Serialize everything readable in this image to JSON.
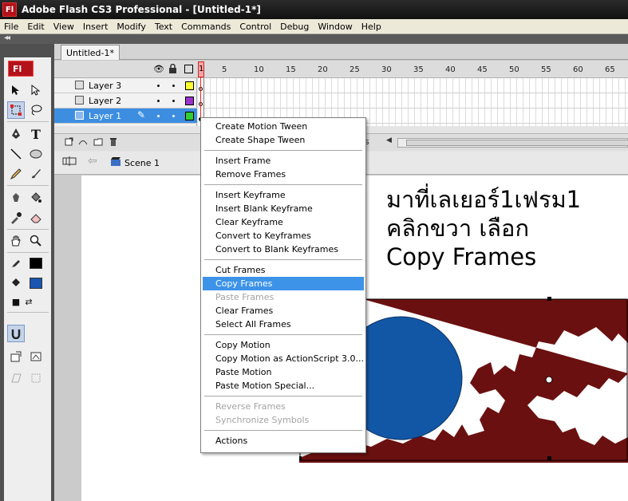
{
  "window": {
    "app_icon": "Fl",
    "title": "Adobe Flash CS3 Professional - [Untitled-1*]"
  },
  "menubar": [
    "File",
    "Edit",
    "View",
    "Insert",
    "Modify",
    "Text",
    "Commands",
    "Control",
    "Debug",
    "Window",
    "Help"
  ],
  "tools": {
    "logo": "Fl",
    "items": [
      "selection-tool",
      "subselection-tool",
      "free-transform-tool",
      "lasso-tool",
      "pen-tool",
      "text-tool",
      "line-tool",
      "oval-tool",
      "pencil-tool",
      "brush-tool",
      "ink-bottle-tool",
      "paint-bucket-tool",
      "eyedropper-tool",
      "eraser-tool",
      "hand-tool",
      "zoom-tool",
      "stroke-color",
      "fill-color",
      "snap-to-objects"
    ],
    "stroke_color": "#000000",
    "fill_color": "#1a56b0"
  },
  "document_tab": "Untitled-1*",
  "timeline": {
    "ruler": [
      "1",
      "5",
      "10",
      "15",
      "20",
      "25",
      "30",
      "35",
      "40",
      "45",
      "50",
      "55",
      "60",
      "65"
    ],
    "layers": [
      {
        "name": "Layer 3",
        "color": "#ffff33",
        "active": false
      },
      {
        "name": "Layer 2",
        "color": "#9933cc",
        "active": false
      },
      {
        "name": "Layer 1",
        "color": "#33cc33",
        "active": true
      }
    ],
    "footer_fps_fragment": "s"
  },
  "editbar": {
    "scene": "Scene 1"
  },
  "stage": {
    "annotation": {
      "line1": "มาที่เลเยอร์1เฟรม1",
      "line2": "คลิกขวา เลือก",
      "line3": "Copy Frames"
    },
    "circle_color": "#1257a6",
    "map_color": "#6b1010"
  },
  "context_menu": {
    "groups": [
      [
        {
          "label": "Create Motion Tween",
          "enabled": true
        },
        {
          "label": "Create Shape Tween",
          "enabled": true
        }
      ],
      [
        {
          "label": "Insert Frame",
          "enabled": true
        },
        {
          "label": "Remove Frames",
          "enabled": true
        }
      ],
      [
        {
          "label": "Insert Keyframe",
          "enabled": true
        },
        {
          "label": "Insert Blank Keyframe",
          "enabled": true
        },
        {
          "label": "Clear Keyframe",
          "enabled": true
        },
        {
          "label": "Convert to Keyframes",
          "enabled": true
        },
        {
          "label": "Convert to Blank Keyframes",
          "enabled": true
        }
      ],
      [
        {
          "label": "Cut Frames",
          "enabled": true
        },
        {
          "label": "Copy Frames",
          "enabled": true,
          "highlighted": true
        },
        {
          "label": "Paste Frames",
          "enabled": false
        },
        {
          "label": "Clear Frames",
          "enabled": true
        },
        {
          "label": "Select All Frames",
          "enabled": true
        }
      ],
      [
        {
          "label": "Copy Motion",
          "enabled": true
        },
        {
          "label": "Copy Motion as ActionScript 3.0...",
          "enabled": true
        },
        {
          "label": "Paste Motion",
          "enabled": true
        },
        {
          "label": "Paste Motion Special...",
          "enabled": true
        }
      ],
      [
        {
          "label": "Reverse Frames",
          "enabled": false
        },
        {
          "label": "Synchronize Symbols",
          "enabled": false
        }
      ],
      [
        {
          "label": "Actions",
          "enabled": true
        }
      ]
    ]
  }
}
